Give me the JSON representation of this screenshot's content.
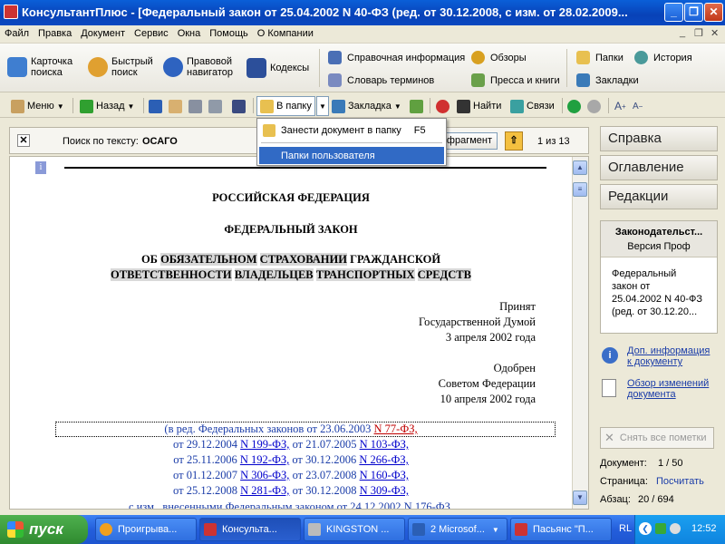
{
  "window": {
    "title": "КонсультантПлюс - [Федеральный закон от 25.04.2002 N 40-ФЗ (ред. от 30.12.2008, с изм. от 28.02.2009..."
  },
  "menu": [
    "Файл",
    "Правка",
    "Документ",
    "Сервис",
    "Окна",
    "Помощь",
    "О Компании"
  ],
  "bigbar": {
    "card_l1": "Карточка",
    "card_l2": "поиска",
    "quick_l1": "Быстрый",
    "quick_l2": "поиск",
    "nav_l1": "Правовой",
    "nav_l2": "навигатор",
    "codes": "Кодексы",
    "ref": "Справочная информация",
    "dict": "Словарь терминов",
    "reviews": "Обзоры",
    "press": "Пресса и книги",
    "folders": "Папки",
    "history": "История",
    "bookmarks": "Закладки"
  },
  "toolbar": {
    "menu": "Меню",
    "back": "Назад",
    "to_folder": "В папку",
    "bookmark": "Закладка",
    "find": "Найти",
    "links": "Связи"
  },
  "dropdown": {
    "item1": "Занести документ в папку",
    "item1_key": "F5",
    "item2": "Папки пользователя"
  },
  "search": {
    "label": "Поиск по тексту:",
    "term": "ОСАГО",
    "fragment_btn": "фрагмент",
    "counter": "1 из 13"
  },
  "doc": {
    "h1": "РОССИЙСКАЯ ФЕДЕРАЦИЯ",
    "h2": "ФЕДЕРАЛЬНЫЙ ЗАКОН",
    "t_ob": "ОБ",
    "t_w1": "ОБЯЗАТЕЛЬНОМ",
    "t_w2": "СТРАХОВАНИИ",
    "t_w3": "ГРАЖДАНСКОЙ",
    "t_w4": "ОТВЕТСТВЕННОСТИ",
    "t_w5": "ВЛАДЕЛЬЦЕВ",
    "t_w6": "ТРАНСПОРТНЫХ",
    "t_w7": "СРЕДСТВ",
    "acc1": "Принят",
    "acc2": "Государственной Думой",
    "acc3": "3 апреля 2002 года",
    "app1": "Одобрен",
    "app2": "Советом Федерации",
    "app3": "10 апреля 2002 года",
    "ed1a": "(в ред. Федеральных законов от 23.06.2003",
    "ed1b": "N 77-ФЗ,",
    "ed2a": "от 29.12.2004",
    "ed2b": "N 199-ФЗ,",
    "ed2c": "от 21.07.2005",
    "ed2d": "N 103-ФЗ,",
    "ed3a": "от 25.11.2006",
    "ed3b": "N 192-ФЗ,",
    "ed3c": "от 30.12.2006",
    "ed3d": "N 266-ФЗ,",
    "ed4a": "от 01.12.2007",
    "ed4b": "N 306-ФЗ,",
    "ed4c": "от 23.07.2008",
    "ed4d": "N 160-ФЗ,",
    "ed5a": "от 25.12.2008",
    "ed5b": "N 281-ФЗ,",
    "ed5c": "от 30.12.2008",
    "ed5d": "N 309-ФЗ,",
    "ed6": "с изм., внесенными Федеральным законом от 24.12.2002 N 176-ФЗ,"
  },
  "rpanel": {
    "tab1": "Справка",
    "tab2": "Оглавление",
    "tab3": "Редакции",
    "box_title": "Законодательст...",
    "box_sub": "Версия Проф",
    "box_t1": "Федеральный",
    "box_t2": "закон от",
    "box_t3": "25.04.2002 N 40-ФЗ",
    "box_t4": "(ред. от 30.12.20...",
    "addinfo1": "Доп. информация",
    "addinfo2": "к документу",
    "review1": "Обзор изменений",
    "review2": "документа",
    "clear": "Снять все пометки",
    "doc_label": "Документ:",
    "doc_val": "1 / 50",
    "page_label": "Страница:",
    "page_val": "Посчитать",
    "par_label": "Абзац:",
    "par_val": "20 / 694"
  },
  "taskbar": {
    "start": "пуск",
    "tasks": [
      "Проигрыва...",
      "Консульта...",
      "KINGSTON ...",
      "2 Microsof...",
      "Пасьянс \"П..."
    ],
    "lang": "RL",
    "clock": "12:52"
  },
  "colors": {
    "accent": "#316ac5",
    "highlight": "#d9d9d9",
    "link": "#0000cc",
    "link_red": "#c00000"
  }
}
